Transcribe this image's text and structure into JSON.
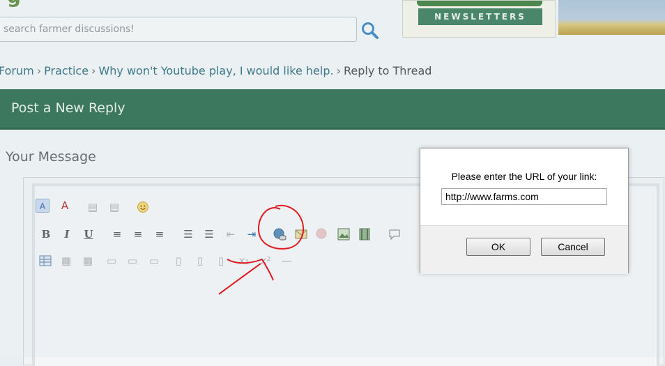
{
  "search": {
    "placeholder": "search farmer discussions!"
  },
  "ad": {
    "newsletter_label": "NEWSLETTERS"
  },
  "breadcrumb": [
    {
      "label": "Forum"
    },
    {
      "label": "Practice"
    },
    {
      "label": "Why won't Youtube play, I would like help."
    },
    {
      "label": "Reply to Thread"
    }
  ],
  "breadcrumb_separator": "›",
  "reply_header": {
    "title": "Post a New Reply"
  },
  "editor": {
    "label": "Your Message",
    "toolbar_icons": [
      "switch-editor-mode-icon",
      "remove-format-icon",
      "paste-icon",
      "paste-text-icon",
      "smiley-icon",
      "bold-icon",
      "italic-icon",
      "underline-icon",
      "align-left-icon",
      "align-center-icon",
      "align-right-icon",
      "ordered-list-icon",
      "unordered-list-icon",
      "outdent-icon",
      "indent-icon",
      "insert-link-icon",
      "email-link-icon",
      "unlink-icon",
      "insert-image-icon",
      "insert-video-icon",
      "quote-icon",
      "table-icon",
      "table-row-icon",
      "table-cell-icon"
    ]
  },
  "dialog": {
    "prompt": "Please enter the URL of your link:",
    "url_value": "http://www.farms.com",
    "ok_label": "OK",
    "cancel_label": "Cancel"
  },
  "colors": {
    "header_green": "#2a6b4c",
    "link_teal": "#2b6c7e",
    "annotation_red": "#e0181e"
  }
}
